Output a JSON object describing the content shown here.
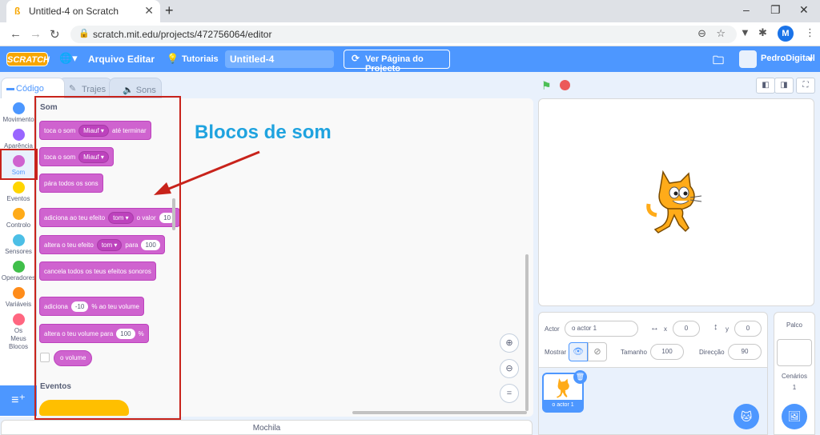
{
  "browser": {
    "tab_title": "Untitled-4 on Scratch",
    "tab_close": "✕",
    "new_tab": "+",
    "url": "scratch.mit.edu/projects/472756064/editor",
    "profile_initial": "M",
    "window_controls": [
      "–",
      "❐",
      "✕"
    ]
  },
  "menubar": {
    "logo": "SCRATCH",
    "file": "Arquivo",
    "edit": "Editar",
    "tutorials": "Tutoriais",
    "project_title": "Untitled-4",
    "view_project": "Ver Página do Projecto",
    "username": "PedroDigitall"
  },
  "editor_tabs": {
    "code": "Código",
    "costumes": "Trajes",
    "sounds": "Sons"
  },
  "categories": [
    {
      "label": "Movimento",
      "color": "#4c97ff"
    },
    {
      "label": "Aparência",
      "color": "#9966ff"
    },
    {
      "label": "Som",
      "color": "#cf63cf",
      "selected": true
    },
    {
      "label": "Eventos",
      "color": "#ffd500"
    },
    {
      "label": "Controlo",
      "color": "#ffab19"
    },
    {
      "label": "Sensores",
      "color": "#4cbfe6"
    },
    {
      "label": "Operadores",
      "color": "#40bf4a"
    },
    {
      "label": "Variáveis",
      "color": "#ff8c1a"
    },
    {
      "label": "Os Meus Blocos",
      "color": "#ff6680"
    }
  ],
  "palette": {
    "section_sound": "Som",
    "section_events": "Eventos",
    "blocks": {
      "play_until_done": {
        "text": "toca o som",
        "dropdown": "Miauf",
        "suffix": "até terminar"
      },
      "start_sound": {
        "text": "toca o som",
        "dropdown": "Miauf"
      },
      "stop_all": {
        "text": "pára todos os sons"
      },
      "change_effect": {
        "text": "adiciona ao teu efeito",
        "dropdown": "tom",
        "mid": "o valor",
        "value": "10"
      },
      "set_effect": {
        "text": "altera o teu efeito",
        "dropdown": "tom",
        "mid": "para",
        "value": "100"
      },
      "clear_effects": {
        "text": "cancela todos os teus efeitos sonoros"
      },
      "change_volume": {
        "text": "adiciona",
        "value": "-10",
        "suffix": "% ao teu volume"
      },
      "set_volume": {
        "text": "altera o teu volume para",
        "value": "100",
        "suffix": "%"
      },
      "volume": {
        "text": "o volume"
      }
    }
  },
  "annotation": {
    "label": "Blocos de som",
    "color": "#1fa3df",
    "box_color": "#c8231b"
  },
  "backpack": "Mochila",
  "sprite_info": {
    "sprite_label": "Actor",
    "sprite_name": "o actor 1",
    "x_label": "x",
    "x_value": "0",
    "y_label": "y",
    "y_value": "0",
    "show_label": "Mostrar",
    "size_label": "Tamanho",
    "size_value": "100",
    "direction_label": "Direcção",
    "direction_value": "90"
  },
  "sprite_list": {
    "sprite_thumb_label": "o actor 1"
  },
  "stage_pane": {
    "title": "Palco",
    "backdrops_label": "Cenários",
    "backdrops_count": "1"
  }
}
